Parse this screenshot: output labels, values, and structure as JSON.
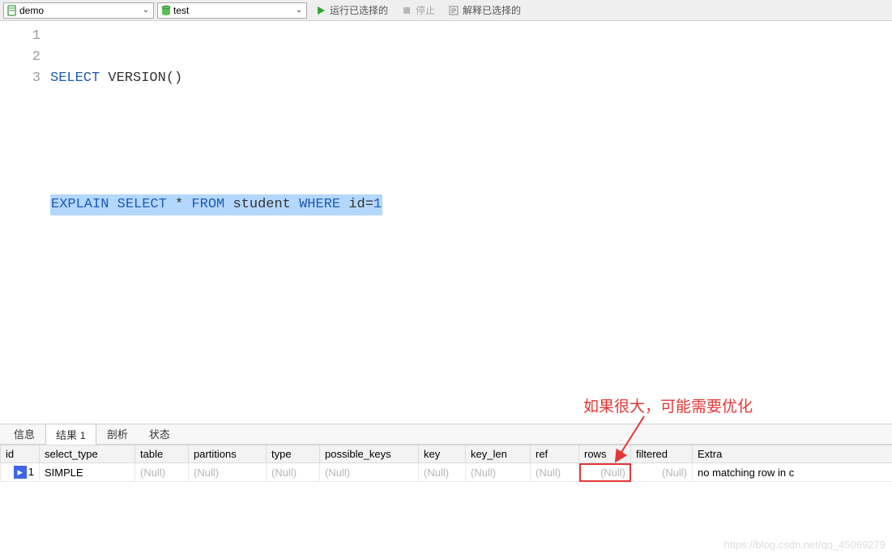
{
  "toolbar": {
    "database": "demo",
    "connection": "test",
    "run_label": "运行已选择的",
    "stop_label": "停止",
    "explain_label": "解释已选择的"
  },
  "editor": {
    "lines": [
      "1",
      "2",
      "3"
    ],
    "line1_kw1": "SELECT",
    "line1_fn": " VERSION()",
    "line3_kw1": "EXPLAIN",
    "line3_kw2": "SELECT",
    "line3_star": " * ",
    "line3_kw3": "FROM",
    "line3_tbl": " student ",
    "line3_kw4": "WHERE",
    "line3_col": " id=",
    "line3_val": "1"
  },
  "tabs": {
    "info": "信息",
    "result": "结果 1",
    "profile": "剖析",
    "status": "状态"
  },
  "columns": {
    "id": "id",
    "select_type": "select_type",
    "table": "table",
    "partitions": "partitions",
    "type": "type",
    "possible_keys": "possible_keys",
    "key": "key",
    "key_len": "key_len",
    "ref": "ref",
    "rows": "rows",
    "filtered": "filtered",
    "extra": "Extra"
  },
  "row": {
    "marker": "▸",
    "id": "1",
    "select_type": "SIMPLE",
    "table": "(Null)",
    "partitions": "(Null)",
    "type": "(Null)",
    "possible_keys": "(Null)",
    "key": "(Null)",
    "key_len": "(Null)",
    "ref": "(Null)",
    "rows": "(Null)",
    "filtered": "(Null)",
    "extra": "no matching row in c"
  },
  "annotation": "如果很大，可能需要优化",
  "watermark": "https://blog.csdn.net/qq_45069279"
}
